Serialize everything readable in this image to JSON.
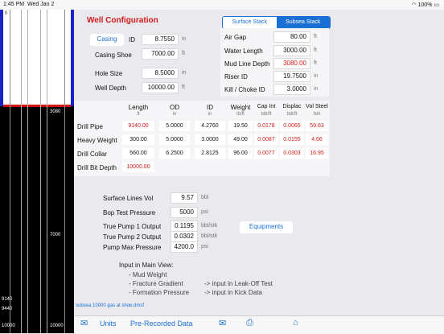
{
  "status": {
    "time": "1:45 PM",
    "date": "Wed Jan 2",
    "battery": "100%"
  },
  "well_diagram": {
    "depths": {
      "top": "0",
      "red_mark": "3080",
      "mid": "7000",
      "d1": "9140",
      "d2": "9440",
      "bottom_left": "10000",
      "bottom_right": "10000"
    }
  },
  "config": {
    "title": "Well Configuration",
    "casing_btn": "Casing",
    "id_label": "ID",
    "id_value": "8.7550",
    "id_unit": "in",
    "casing_shoe_label": "Casing Shoe",
    "casing_shoe_value": "7000.00",
    "casing_shoe_unit": "ft",
    "hole_size_label": "Hole Size",
    "hole_size_value": "8.5000",
    "hole_size_unit": "in",
    "well_depth_label": "Well Depth",
    "well_depth_value": "10000.00",
    "well_depth_unit": "ft"
  },
  "stack": {
    "tabs": [
      "Surface Stack",
      "Subsea Stack"
    ],
    "rows": [
      {
        "label": "Air Gap",
        "value": "80.00",
        "unit": "ft"
      },
      {
        "label": "Water Length",
        "value": "3000.00",
        "unit": "ft"
      },
      {
        "label": "Mud Line Depth",
        "value": "3080.00",
        "unit": "ft"
      },
      {
        "label": "Riser ID",
        "value": "19.7500",
        "unit": "in"
      },
      {
        "label": "Kill / Choke ID",
        "value": "3.0000",
        "unit": "in"
      }
    ]
  },
  "pipes": {
    "headers": [
      {
        "label": "Length",
        "unit": "ft"
      },
      {
        "label": "OD",
        "unit": "in"
      },
      {
        "label": "ID",
        "unit": "in"
      },
      {
        "label": "Weight",
        "unit": "lb/ft"
      },
      {
        "label": "Cap Int",
        "unit": "bbl/ft"
      },
      {
        "label": "Displac",
        "unit": "bbl/ft"
      },
      {
        "label": "Vol Steel",
        "unit": "bbl"
      }
    ],
    "rows": [
      {
        "name": "Drill Pipe",
        "cells": [
          "9140.00",
          "5.0000",
          "4.2760",
          "19.50",
          "0.0178",
          "0.0065",
          "59.63"
        ]
      },
      {
        "name": "Heavy Weight",
        "cells": [
          "300.00",
          "5.0000",
          "3.0000",
          "49.00",
          "0.0087",
          "0.0155",
          "4.66"
        ]
      },
      {
        "name": "Drill Collar",
        "cells": [
          "560.00",
          "6.2500",
          "2.8125",
          "96.00",
          "0.0077",
          "0.0303",
          "16.95"
        ]
      }
    ],
    "bit_label": "Drill Bit Depth",
    "bit_value": "10000.00"
  },
  "volumes": {
    "surface_lines": {
      "label": "Surface Lines Vol",
      "value": "9.57",
      "unit": "bbl"
    },
    "bop_test": {
      "label": "Bop Test Pressure",
      "value": "5000",
      "unit": "psi"
    },
    "pump1": {
      "label": "True Pump 1 Output",
      "value": "0.1195",
      "unit": "bbl/stk"
    },
    "pump2": {
      "label": "True Pump 2 Output",
      "value": "0.0302",
      "unit": "bbl/stk"
    },
    "pump_max": {
      "label": "Pump Max Pressure",
      "value": "4200.0",
      "unit": "psi"
    },
    "equipments_btn": "Equipments"
  },
  "notes": {
    "heading": "Input in Main View:",
    "l1": "- Mud Weight",
    "l2": "- Fracture Gradient",
    "l2b": "-> input in Leak-Off Test",
    "l3": "- Formation Pressure",
    "l3b": "-> input in Kick Data"
  },
  "footer": {
    "file": "subsea 10000 gas at shoe.dmsf"
  },
  "tabbar": {
    "units": "Units",
    "prerecorded": "Pre-Recorded Data"
  }
}
